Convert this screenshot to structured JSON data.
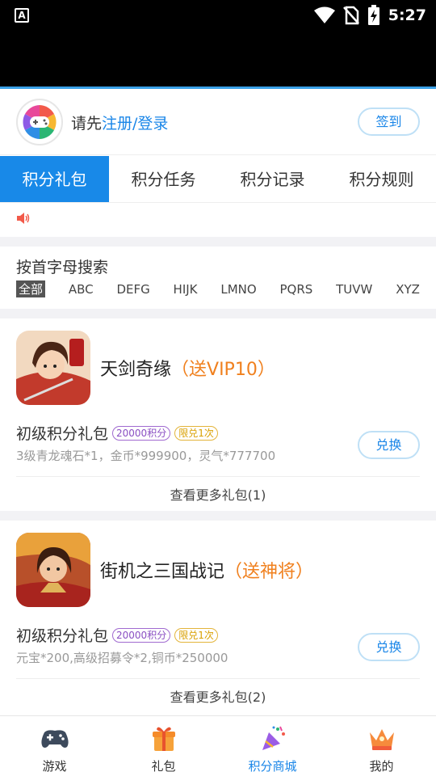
{
  "status_bar": {
    "time": "5:27"
  },
  "user": {
    "prompt": "请先",
    "login_link": "注册/登录",
    "signin_label": "签到"
  },
  "tabs": [
    {
      "label": "积分礼包",
      "active": true
    },
    {
      "label": "积分任务",
      "active": false
    },
    {
      "label": "积分记录",
      "active": false
    },
    {
      "label": "积分规则",
      "active": false
    }
  ],
  "search": {
    "title": "按首字母搜索",
    "letters": [
      "全部",
      "ABC",
      "DEFG",
      "HIJK",
      "LMNO",
      "PQRS",
      "TUVW",
      "XYZ"
    ]
  },
  "games": [
    {
      "name": "天剑奇缘",
      "promo": "（送VIP10）",
      "package_name": "初级积分礼包",
      "points_tag": "20000积分",
      "limit_tag": "限兑1次",
      "description": "3级青龙魂石*1，金币*999900，灵气*777700",
      "exchange_label": "兑换",
      "more_label": "查看更多礼包(1)"
    },
    {
      "name": "街机之三国战记",
      "promo": "（送神将）",
      "package_name": "初级积分礼包",
      "points_tag": "20000积分",
      "limit_tag": "限兑1次",
      "description": "元宝*200,高级招募令*2,铜币*250000",
      "exchange_label": "兑换",
      "more_label": "查看更多礼包(2)"
    }
  ],
  "bottom_nav": [
    {
      "label": "游戏",
      "icon": "gamepad-icon",
      "active": false
    },
    {
      "label": "礼包",
      "icon": "gift-icon",
      "active": false
    },
    {
      "label": "积分商城",
      "icon": "party-popper-icon",
      "active": true
    },
    {
      "label": "我的",
      "icon": "crown-icon",
      "active": false
    }
  ],
  "colors": {
    "accent": "#1889e8",
    "promo": "#f0801e",
    "points_tag": "#8a4fc3",
    "limit_tag": "#d9a000"
  }
}
